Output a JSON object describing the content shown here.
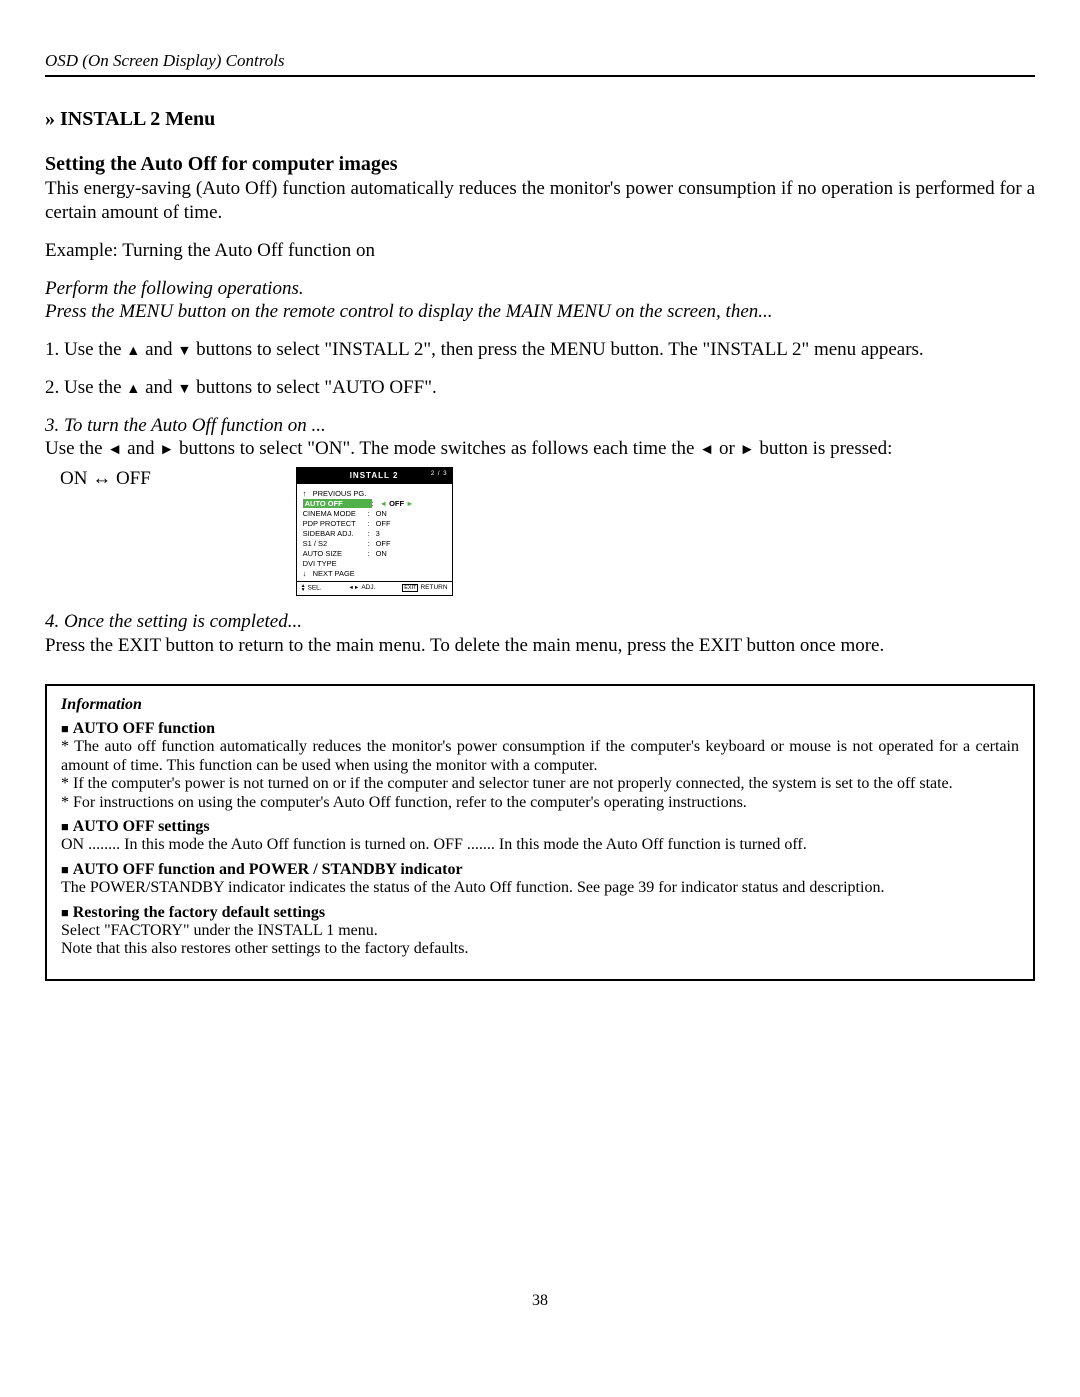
{
  "header": "OSD (On Screen Display) Controls",
  "menu_h": "» INSTALL 2 Menu",
  "sub_h": "Setting the Auto Off for computer images",
  "intro_p": "This energy-saving (Auto Off) function automatically reduces the monitor's power consumption if no operation is performed for a certain amount of time.",
  "example_p": "Example: Turning the Auto Off function on",
  "perform_p": "Perform the following operations.",
  "press_menu_p": "Press the MENU button on the remote control to display the MAIN MENU on the screen, then...",
  "step1_a": "1. Use the ",
  "step1_b": " and ",
  "step1_c": " buttons to select \"INSTALL 2\", then press the MENU button. The \"INSTALL 2\" menu appears.",
  "step2_a": "2. Use the ",
  "step2_b": " and ",
  "step2_c": " buttons to select \"AUTO OFF\".",
  "step3_h": "3. To turn the Auto Off function on ...",
  "step3_a": "Use the ",
  "step3_b": " and ",
  "step3_c": " buttons to select \"ON\". The mode switches as follows each time the ",
  "step3_d": " or ",
  "step3_e": " button is pressed:",
  "onoff": "ON ↔ OFF",
  "osd": {
    "title": "INSTALL 2",
    "page": "2 / 3",
    "prev": "PREVIOUS PG.",
    "rows": [
      {
        "k": "AUTO OFF",
        "v": "OFF",
        "sel": true
      },
      {
        "k": "CINEMA MODE",
        "v": "ON"
      },
      {
        "k": "PDP PROTECT",
        "v": "OFF"
      },
      {
        "k": "SIDEBAR ADJ.",
        "v": "3"
      },
      {
        "k": "S1 / S2",
        "v": "OFF"
      },
      {
        "k": "AUTO SIZE",
        "v": "ON"
      },
      {
        "k": "DVI TYPE",
        "v": ""
      }
    ],
    "next": "NEXT PAGE",
    "foot_sel": "SEL.",
    "foot_adj": "ADJ.",
    "foot_exit": "EXIT",
    "foot_return": "RETURN"
  },
  "step4_h": "4. Once the setting is completed...",
  "step4_p": "Press the EXIT button to return to the main menu. To delete the main menu, press the EXIT button once more.",
  "info": {
    "h": "Information",
    "s1": "AUTO OFF function",
    "p1a": "* The auto off function automatically reduces the monitor's power consumption if the computer's keyboard or mouse is not operated for a certain amount of time. This function can be used when using the monitor with a computer.",
    "p1b": "* If the computer's power is not turned on or if the computer and selector tuner are not properly connected, the system is set to the off state.",
    "p1c": "* For instructions on using the computer's Auto Off function, refer to the computer's operating instructions.",
    "s2": "AUTO OFF settings",
    "p2": "ON ........ In this mode the Auto Off function is turned on. OFF ....... In this mode the Auto Off function is turned off.",
    "s3": "AUTO OFF function and POWER / STANDBY indicator",
    "p3": "The POWER/STANDBY indicator indicates the status of the Auto Off function. See page 39 for indicator status and description.",
    "s4": "Restoring the factory default settings",
    "p4a": "Select \"FACTORY\" under the INSTALL 1 menu.",
    "p4b": "Note that this also restores other settings to the factory defaults."
  },
  "page_num": "38"
}
